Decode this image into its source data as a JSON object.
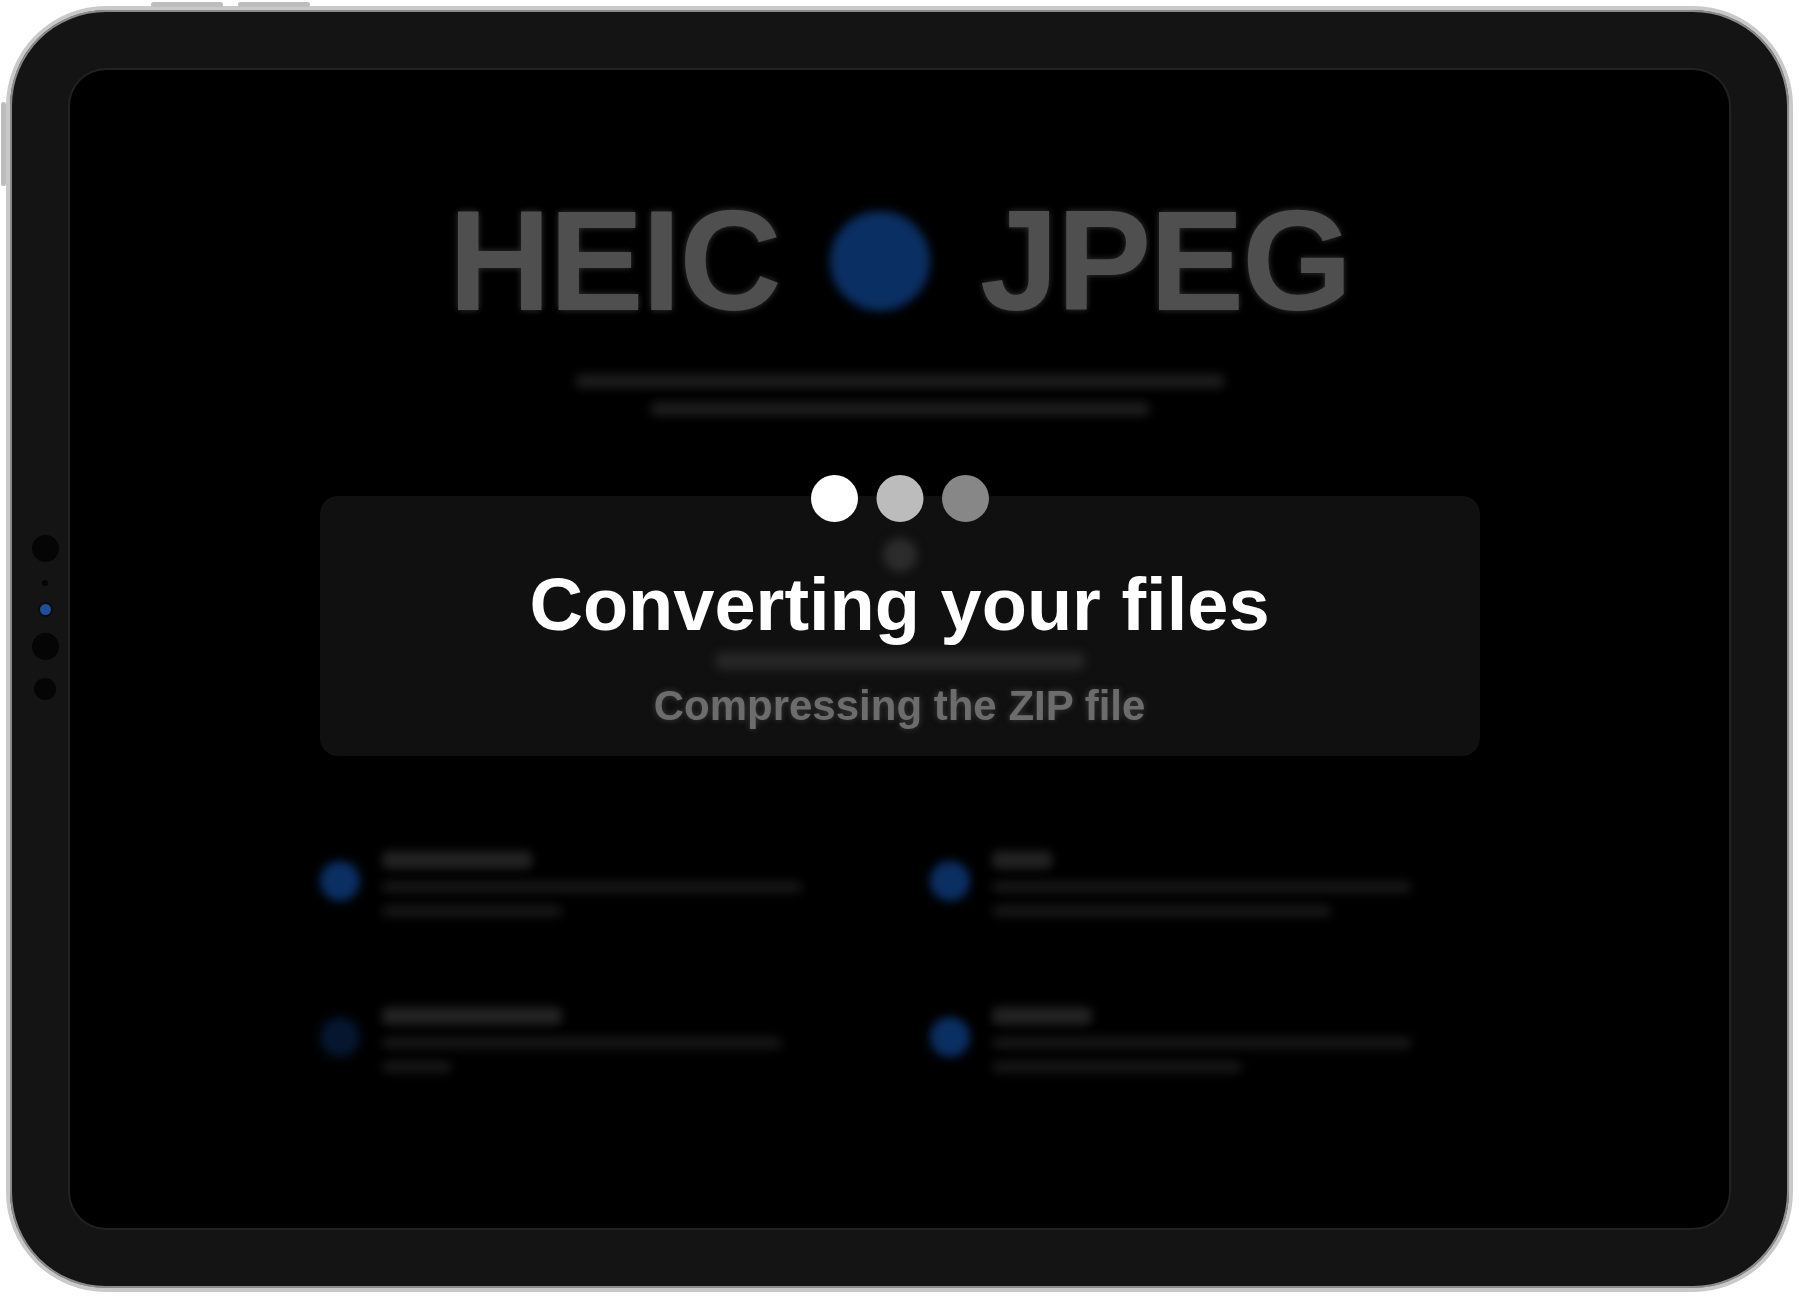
{
  "background": {
    "title_left": "HEIC",
    "title_right": "JPEG",
    "status": "Compressing the ZIP file"
  },
  "overlay": {
    "message": "Converting your files"
  }
}
